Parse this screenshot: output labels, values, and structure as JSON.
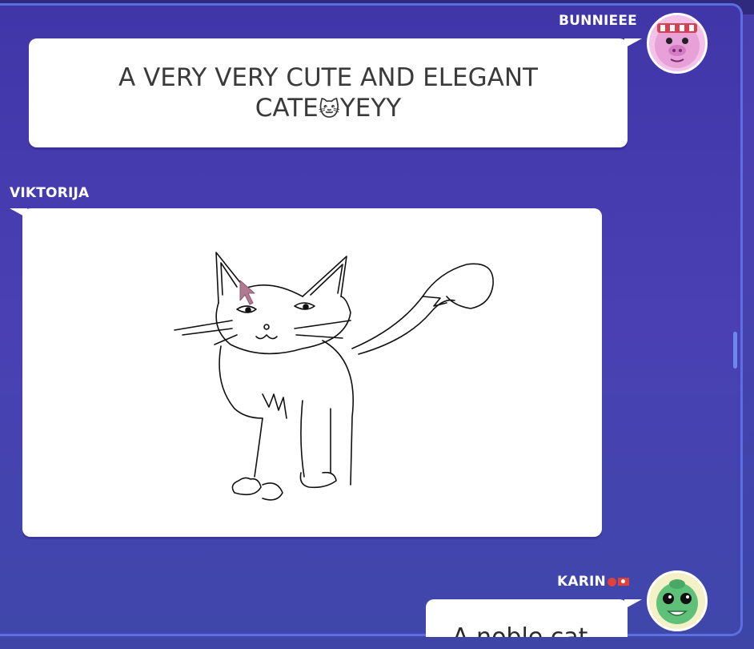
{
  "messages": [
    {
      "author": "BUNNIEEE",
      "text_line1": "A VERY VERY CUTE AND ELEGANT",
      "text_line2_pre": "CATE",
      "text_emoji": "🐱",
      "text_line2_post": "YEYY"
    },
    {
      "author": "VIKTORIJA",
      "drawing": "cat sketch"
    },
    {
      "author": "KARIN",
      "text": "A noble cat"
    }
  ],
  "colors": {
    "background": "#4338ae",
    "bubble": "#ffffff",
    "scroll_thumb": "#6e86f0",
    "accent_border": "#5b6fe0"
  },
  "icons": {
    "bunnieee_avatar": "pig-avatar-icon",
    "karin_avatar": "alien-avatar-icon"
  }
}
